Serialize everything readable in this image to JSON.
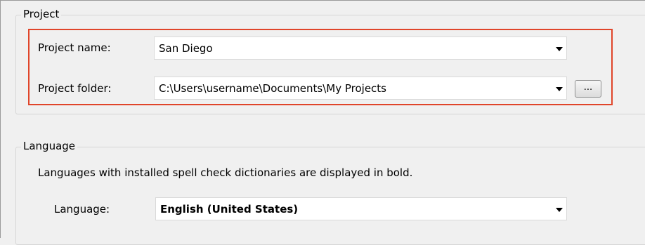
{
  "project": {
    "legend": "Project",
    "name_label": "Project name:",
    "name_value": "San Diego",
    "folder_label": "Project folder:",
    "folder_value": "C:\\Users\\username\\Documents\\My Projects",
    "browse_label": "...",
    "highlight_color": "#e0452a"
  },
  "language": {
    "legend": "Language",
    "info": "Languages with installed spell check dictionaries are displayed in bold.",
    "label": "Language:",
    "value": "English (United States)"
  },
  "icons": {
    "dropdown": "chevron-down-icon"
  }
}
